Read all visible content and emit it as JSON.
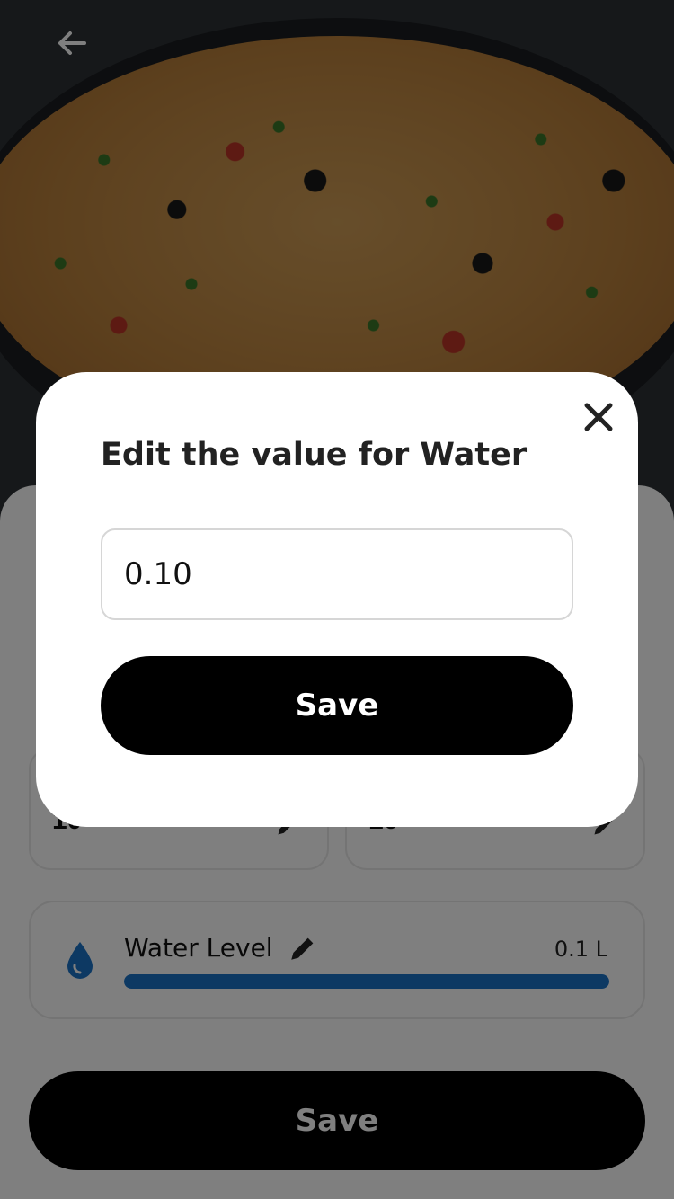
{
  "page": {
    "back_icon": "arrow-left-icon",
    "hero_image": "rice-pilaf-photo"
  },
  "stats": {
    "left_value": "10",
    "right_value": "10",
    "edit_icon": "pencil-icon"
  },
  "water": {
    "label": "Water Level",
    "amount": "0.1 L",
    "icon": "water-drop-icon",
    "level_fraction": 1.0,
    "accent": "#1a73c7"
  },
  "footer": {
    "save_label": "Save"
  },
  "modal": {
    "title": "Edit the value for Water",
    "input_value": "0.10",
    "save_label": "Save",
    "close_icon": "close-icon"
  }
}
